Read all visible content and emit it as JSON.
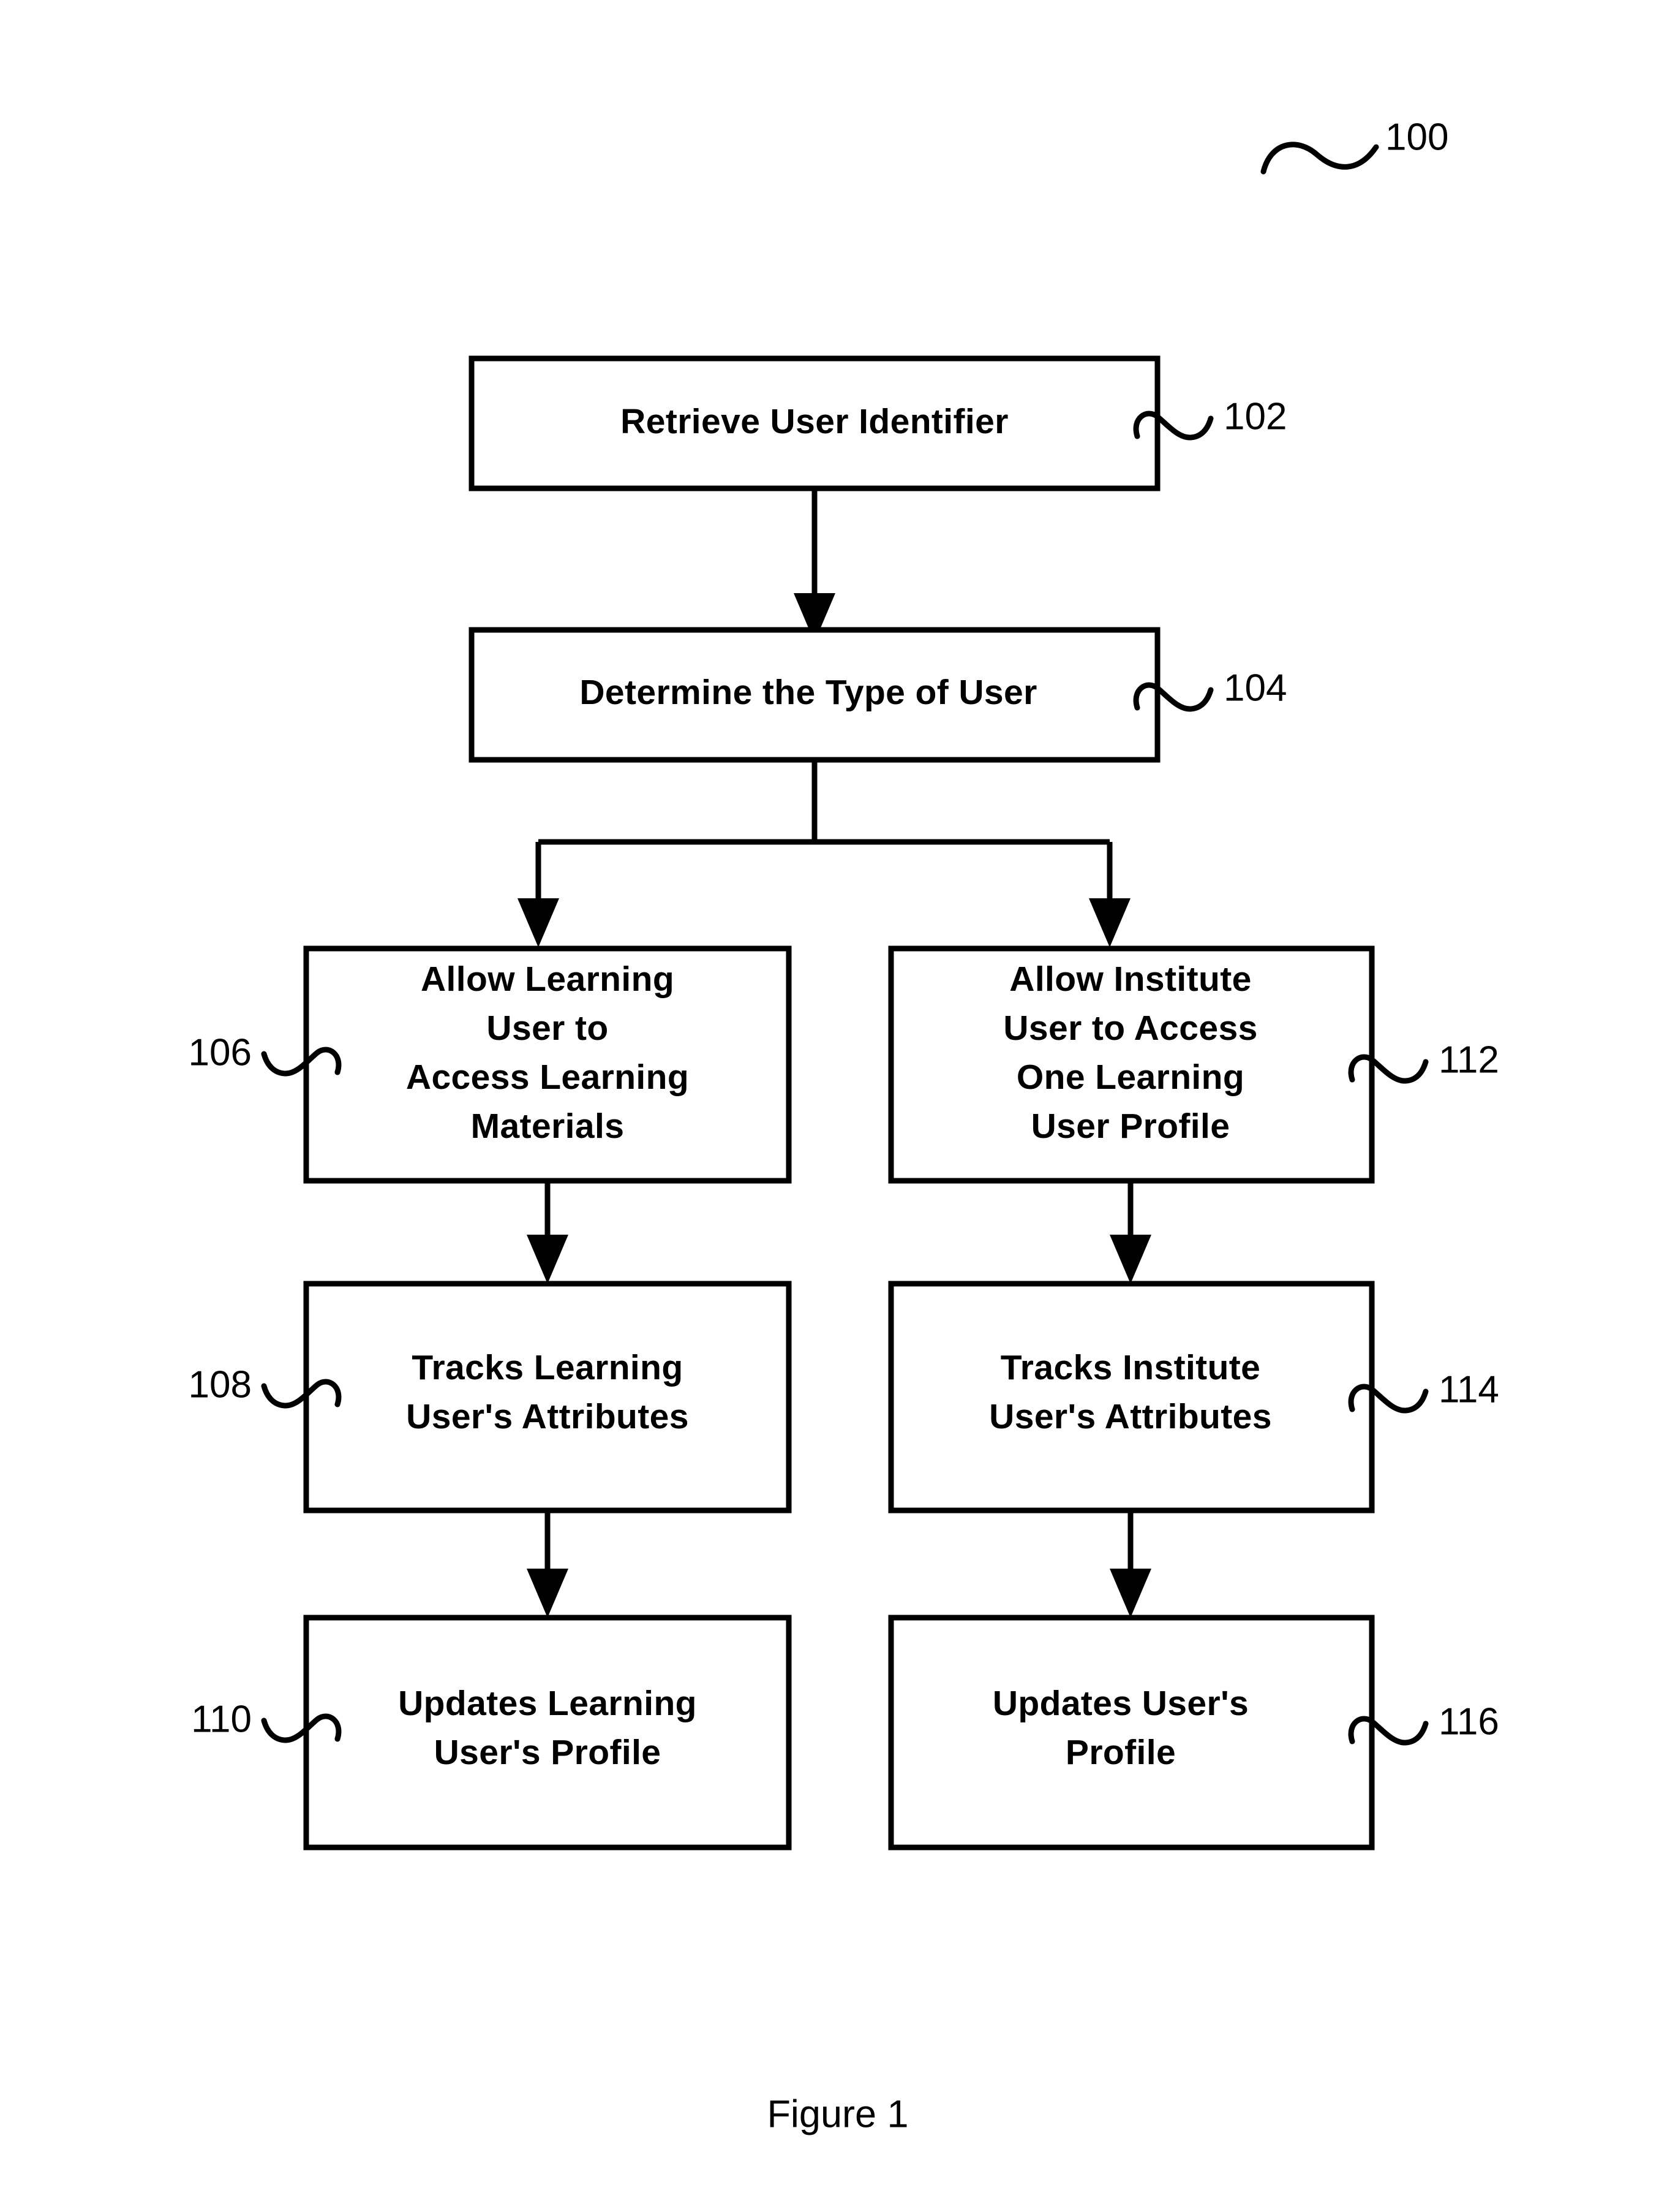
{
  "figure": {
    "caption": "Figure 1",
    "overall_ref": "100"
  },
  "nodes": [
    {
      "ref": "102",
      "name": "retrieve-user-identifier",
      "lines": [
        "Retrieve User Identifier"
      ],
      "ref_side": "right"
    },
    {
      "ref": "104",
      "name": "determine-type-of-user",
      "lines": [
        "Determine the Type of User"
      ],
      "ref_side": "right"
    },
    {
      "ref": "106",
      "name": "allow-learning-user-access-materials",
      "lines": [
        "Allow Learning",
        "User to",
        "Access Learning",
        "Materials"
      ],
      "ref_side": "left"
    },
    {
      "ref": "112",
      "name": "allow-institute-user-access-profile",
      "lines": [
        "Allow Institute",
        "User to Access",
        "One Learning",
        "User Profile"
      ],
      "ref_side": "right"
    },
    {
      "ref": "108",
      "name": "tracks-learning-user-attributes",
      "lines": [
        "Tracks Learning",
        "User's Attributes"
      ],
      "ref_side": "left"
    },
    {
      "ref": "114",
      "name": "tracks-institute-user-attributes",
      "lines": [
        "Tracks Institute",
        "User's Attributes"
      ],
      "ref_side": "right"
    },
    {
      "ref": "110",
      "name": "updates-learning-user-profile",
      "lines": [
        "Updates Learning",
        "User's Profile"
      ],
      "ref_side": "left"
    },
    {
      "ref": "116",
      "name": "updates-user-profile",
      "lines": [
        "Updates User's",
        "Profile"
      ],
      "ref_side": "right"
    }
  ],
  "colors": {
    "ink": "#000000",
    "paper": "#ffffff"
  }
}
